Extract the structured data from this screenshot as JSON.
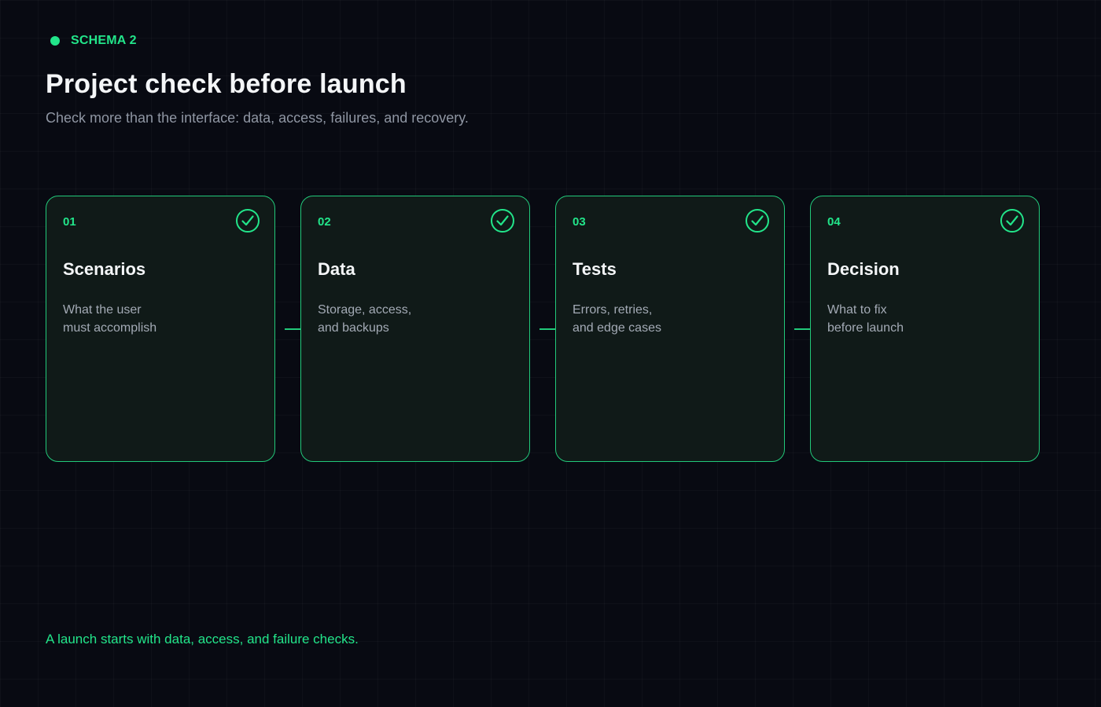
{
  "header": {
    "tag": "SCHEMA 2",
    "title": "Project check before launch",
    "subtitle": "Check more than the interface: data, access, failures, and recovery."
  },
  "steps": [
    {
      "number": "01",
      "title": "Scenarios",
      "description_lines": [
        "What the user",
        "must accomplish"
      ],
      "status_icon": "check-circle-icon"
    },
    {
      "number": "02",
      "title": "Data",
      "description_lines": [
        "Storage, access,",
        "and backups"
      ],
      "status_icon": "check-circle-icon"
    },
    {
      "number": "03",
      "title": "Tests",
      "description_lines": [
        "Errors, retries,",
        "and edge cases"
      ],
      "status_icon": "check-circle-icon"
    },
    {
      "number": "04",
      "title": "Decision",
      "description_lines": [
        "What to fix",
        "before launch"
      ],
      "status_icon": "check-circle-icon"
    }
  ],
  "footer": {
    "note": "A launch starts with data, access, and failure checks."
  },
  "colors": {
    "background": "#080a12",
    "accent": "#22e58a",
    "card_border": "#22c97a",
    "card_background": "#101a18",
    "text_primary": "#f4f6f8",
    "text_secondary": "#a3aab5"
  }
}
